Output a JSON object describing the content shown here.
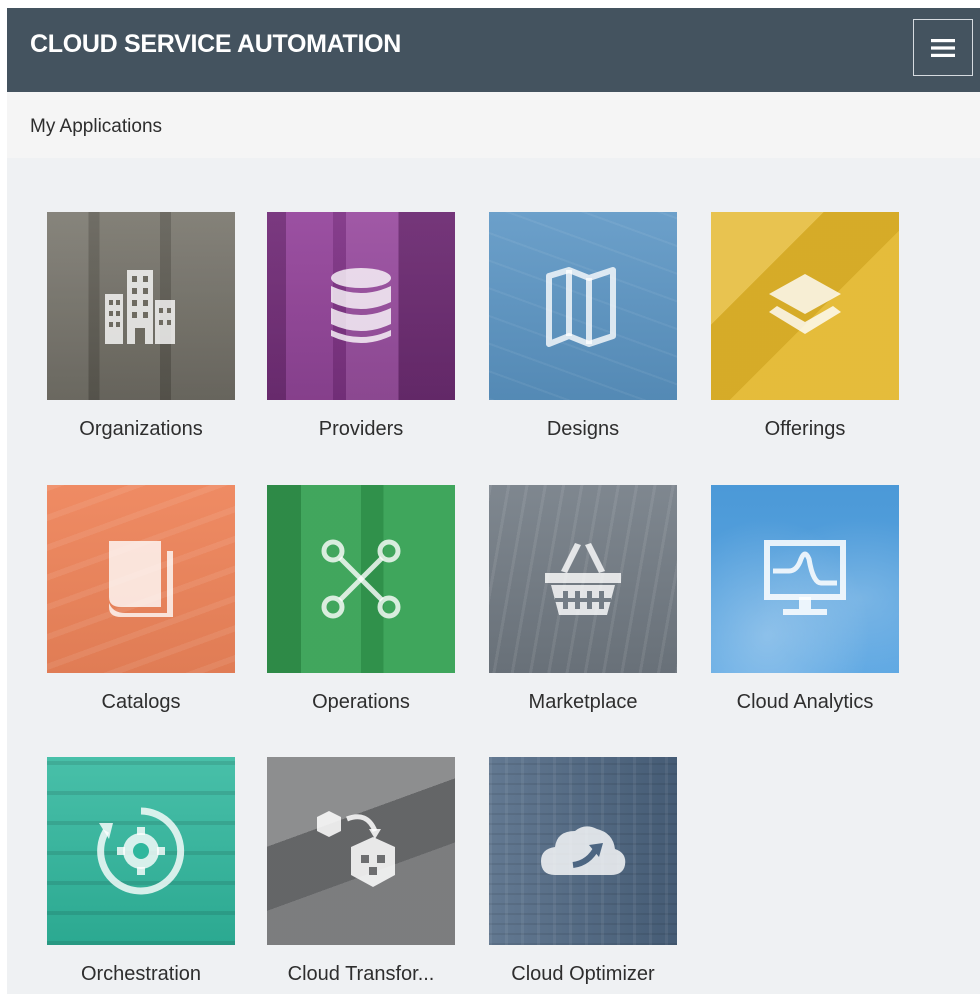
{
  "header": {
    "title": "CLOUD SERVICE AUTOMATION",
    "menu_icon": "hamburger-menu-icon"
  },
  "breadcrumb": {
    "label": "My Applications"
  },
  "tiles": [
    {
      "label": "Organizations",
      "icon": "buildings-icon",
      "color": "#6e6b61"
    },
    {
      "label": "Providers",
      "icon": "database-icon",
      "color": "#8f3a96"
    },
    {
      "label": "Designs",
      "icon": "map-icon",
      "color": "#5b95c4"
    },
    {
      "label": "Offerings",
      "icon": "layers-icon",
      "color": "#e3b62a"
    },
    {
      "label": "Catalogs",
      "icon": "book-icon",
      "color": "#ee845a"
    },
    {
      "label": "Operations",
      "icon": "nodes-icon",
      "color": "#35a153"
    },
    {
      "label": "Marketplace",
      "icon": "basket-icon",
      "color": "#747d86"
    },
    {
      "label": "Cloud Analytics",
      "icon": "monitor-chart-icon",
      "color": "#4e9fe0"
    },
    {
      "label": "Orchestration",
      "icon": "gear-cycle-icon",
      "color": "#2fb79d"
    },
    {
      "label": "Cloud Transfor...",
      "icon": "cube-transfer-icon",
      "color": "#6d6e70"
    },
    {
      "label": "Cloud Optimizer",
      "icon": "cloud-arrow-icon",
      "color": "#4d6682"
    }
  ]
}
